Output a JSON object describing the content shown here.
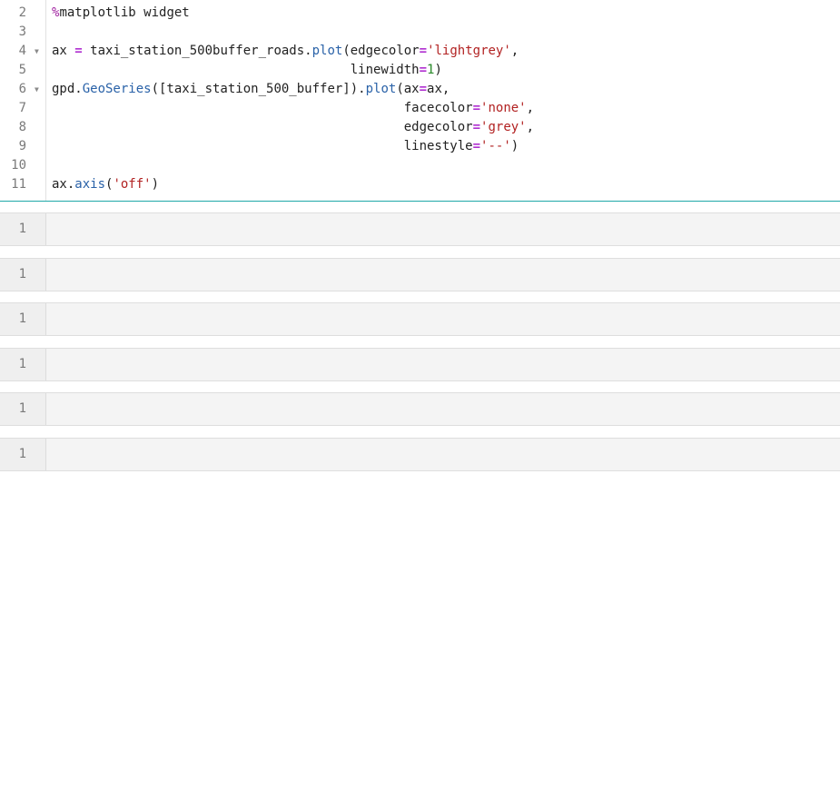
{
  "editor": {
    "lines": [
      {
        "num": "2",
        "fold": false,
        "segments": [
          {
            "t": "%",
            "c": "magic"
          },
          {
            "t": "matplotlib widget",
            "c": ""
          }
        ]
      },
      {
        "num": "3",
        "fold": false,
        "segments": []
      },
      {
        "num": "4",
        "fold": true,
        "segments": [
          {
            "t": "ax ",
            "c": ""
          },
          {
            "t": "=",
            "c": "op"
          },
          {
            "t": " taxi_station_500buffer_roads.",
            "c": ""
          },
          {
            "t": "plot",
            "c": "fn"
          },
          {
            "t": "(edgecolor",
            "c": ""
          },
          {
            "t": "=",
            "c": "op"
          },
          {
            "t": "'lightgrey'",
            "c": "str"
          },
          {
            "t": ",",
            "c": ""
          }
        ]
      },
      {
        "num": "5",
        "fold": false,
        "segments": [
          {
            "t": "                                       linewidth",
            "c": ""
          },
          {
            "t": "=",
            "c": "op"
          },
          {
            "t": "1",
            "c": "num"
          },
          {
            "t": ")",
            "c": ""
          }
        ]
      },
      {
        "num": "6",
        "fold": true,
        "segments": [
          {
            "t": "gpd.",
            "c": ""
          },
          {
            "t": "GeoSeries",
            "c": "fn"
          },
          {
            "t": "([taxi_station_500_buffer]).",
            "c": ""
          },
          {
            "t": "plot",
            "c": "fn"
          },
          {
            "t": "(ax",
            "c": ""
          },
          {
            "t": "=",
            "c": "op"
          },
          {
            "t": "ax,",
            "c": ""
          }
        ]
      },
      {
        "num": "7",
        "fold": false,
        "segments": [
          {
            "t": "                                              facecolor",
            "c": ""
          },
          {
            "t": "=",
            "c": "op"
          },
          {
            "t": "'none'",
            "c": "str"
          },
          {
            "t": ",",
            "c": ""
          }
        ]
      },
      {
        "num": "8",
        "fold": false,
        "segments": [
          {
            "t": "                                              edgecolor",
            "c": ""
          },
          {
            "t": "=",
            "c": "op"
          },
          {
            "t": "'grey'",
            "c": "str"
          },
          {
            "t": ",",
            "c": ""
          }
        ]
      },
      {
        "num": "9",
        "fold": false,
        "segments": [
          {
            "t": "                                              linestyle",
            "c": ""
          },
          {
            "t": "=",
            "c": "op"
          },
          {
            "t": "'--'",
            "c": "str"
          },
          {
            "t": ")",
            "c": ""
          }
        ]
      },
      {
        "num": "10",
        "fold": false,
        "segments": []
      },
      {
        "num": "11",
        "fold": false,
        "segments": [
          {
            "t": "ax.",
            "c": ""
          },
          {
            "t": "axis",
            "c": "fn"
          },
          {
            "t": "(",
            "c": ""
          },
          {
            "t": "'off'",
            "c": "str"
          },
          {
            "t": ")",
            "c": ""
          }
        ]
      }
    ]
  },
  "empty_cells": [
    {
      "line_number": "1"
    },
    {
      "line_number": "1"
    },
    {
      "line_number": "1"
    },
    {
      "line_number": "1"
    },
    {
      "line_number": "1"
    },
    {
      "line_number": "1"
    }
  ],
  "colors": {
    "active_cell_border": "#1fa8a8",
    "keyword_operator": "#b030d0",
    "function": "#2a62a8",
    "string": "#b22222",
    "number": "#2a8a2a",
    "magic": "#a020a0"
  },
  "icons": {
    "fold": "fold-triangle-icon"
  }
}
